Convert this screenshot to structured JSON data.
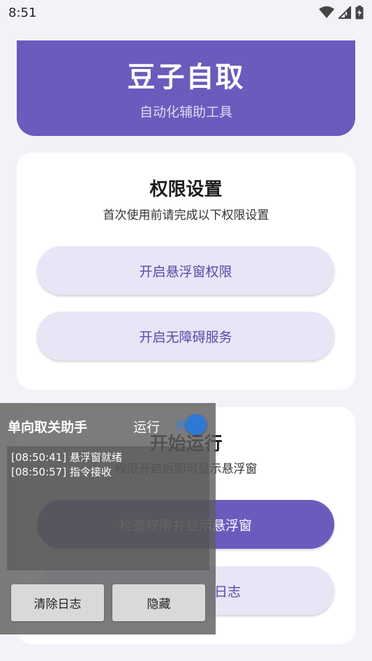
{
  "status": {
    "time": "8:51"
  },
  "header": {
    "title": "豆子自取",
    "subtitle": "自动化辅助工具"
  },
  "permissions": {
    "title": "权限设置",
    "subtitle": "首次使用前请完成以下权限设置",
    "floating_button": "开启悬浮窗权限",
    "accessibility_button": "开启无障碍服务"
  },
  "start": {
    "title": "开始运行",
    "subtitle": "权限开启后即可显示悬浮窗",
    "primary_button": "检查权限并显示悬浮窗",
    "log_button_partial": "日志"
  },
  "overlay": {
    "title": "单向取关助手",
    "run_label": "运行",
    "switch_on": true,
    "logs": [
      "[08:50:41] 悬浮窗就绪",
      "[08:50:57] 指令接收"
    ],
    "clear_button": "清除日志",
    "hide_button": "隐藏"
  }
}
